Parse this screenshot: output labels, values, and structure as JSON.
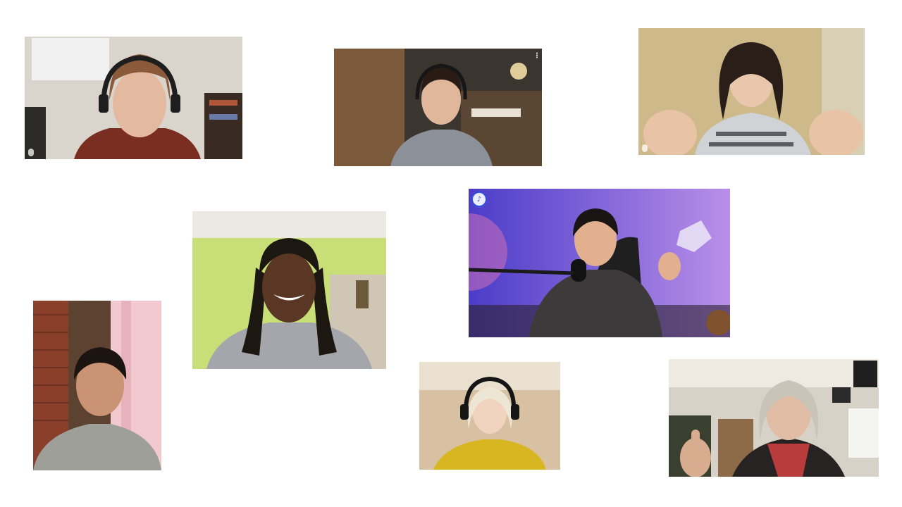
{
  "tiles": [
    {
      "id": "t1",
      "subject": "person-headphones-brown-sweater",
      "muted": true
    },
    {
      "id": "t2",
      "subject": "person-headphones-kitchen",
      "muted": false
    },
    {
      "id": "t3",
      "subject": "person-finger-hearts-plaid",
      "muted": true
    },
    {
      "id": "t4",
      "subject": "person-locs-green-wall",
      "muted": false
    },
    {
      "id": "t5",
      "subject": "person-purple-room-thumbs-up",
      "speaking": true
    },
    {
      "id": "t6",
      "subject": "person-brick-wall",
      "muted": false
    },
    {
      "id": "t7",
      "subject": "person-yellow-sweater-headphones",
      "muted": false
    },
    {
      "id": "t8",
      "subject": "person-thumbs-up-scarf",
      "muted": false
    }
  ],
  "colors": {
    "background": "#ffffff",
    "speaking_ring": "#2a5bd8"
  }
}
